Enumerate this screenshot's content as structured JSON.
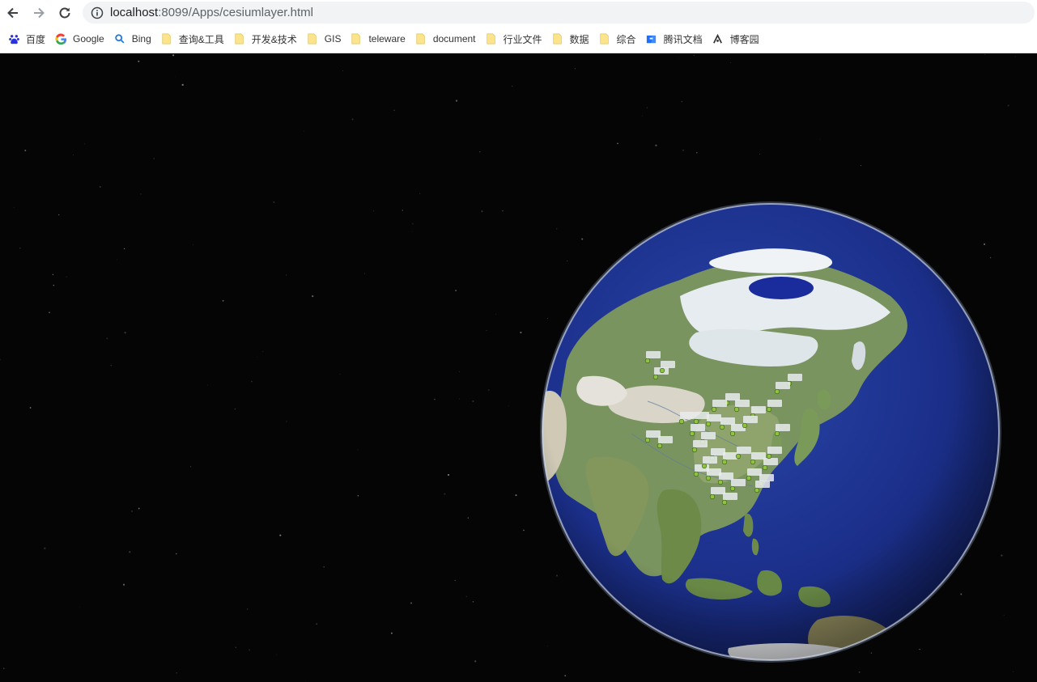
{
  "browser": {
    "url_host": "localhost",
    "url_rest": ":8099/Apps/cesiumlayer.html"
  },
  "bookmarks": [
    {
      "label": "百度",
      "icon": "baidu-paw-icon"
    },
    {
      "label": "Google",
      "icon": "google-g-icon"
    },
    {
      "label": "Bing",
      "icon": "bing-search-icon"
    },
    {
      "label": "查询&工具",
      "icon": "folder-icon"
    },
    {
      "label": "开发&技术",
      "icon": "folder-icon"
    },
    {
      "label": "GIS",
      "icon": "folder-icon"
    },
    {
      "label": "teleware",
      "icon": "folder-icon"
    },
    {
      "label": "document",
      "icon": "folder-icon"
    },
    {
      "label": "行业文件",
      "icon": "folder-icon"
    },
    {
      "label": "数据",
      "icon": "folder-icon"
    },
    {
      "label": "综合",
      "icon": "folder-icon"
    },
    {
      "label": "腾讯文档",
      "icon": "tencent-docs-icon"
    },
    {
      "label": "博客园",
      "icon": "cnblogs-icon"
    }
  ],
  "colors": {
    "ocean": "#1b2f8a",
    "land": "#6f8c55",
    "ice": "#e8eef2",
    "space": "#050505",
    "marker": "#8cc63f"
  },
  "map": {
    "markers": 38
  }
}
